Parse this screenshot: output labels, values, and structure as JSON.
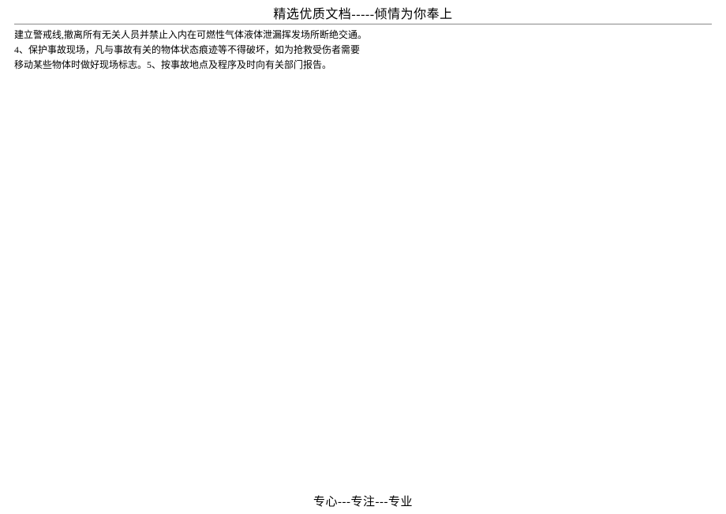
{
  "header": {
    "title": "精选优质文档-----倾情为你奉上"
  },
  "body": {
    "lines": [
      "建立警戒线,撤离所有无关人员并禁止入内在可燃性气体液体泄漏挥发场所断绝交通。",
      "4、保护事故现场，凡与事故有关的物体状态痕迹等不得破坏，如为抢救受伤者需要",
      "移动某些物体时做好现场标志。5、按事故地点及程序及时向有关部门报告。"
    ]
  },
  "footer": {
    "text": "专心---专注---专业"
  }
}
